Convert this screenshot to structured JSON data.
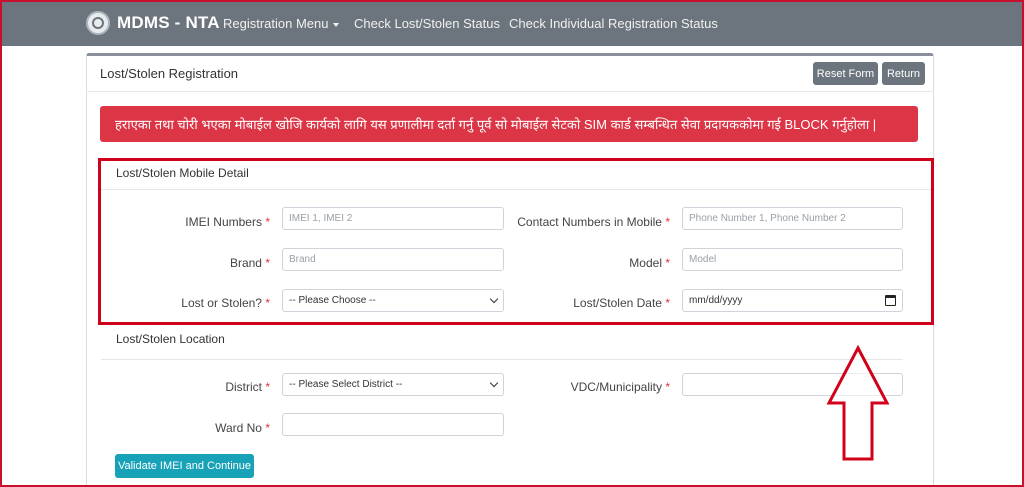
{
  "navbar": {
    "brand": "MDMS - NTA",
    "links": [
      "Registration Menu",
      "Check Lost/Stolen Status",
      "Check Individual Registration Status"
    ]
  },
  "card": {
    "title": "Lost/Stolen Registration",
    "reset_label": "Reset Form",
    "return_label": "Return"
  },
  "alert": {
    "text": "हराएका तथा चोरी भएका मोबाईल खोजि कार्यको लागि यस प्रणालीमा दर्ता गर्नु पूर्व सो मोबाईल सेटको SIM कार्ड सम्बन्धित सेवा प्रदायककोमा गई BLOCK गर्नुहोला |"
  },
  "mobile_detail": {
    "title": "Lost/Stolen Mobile Detail",
    "imei_label": "IMEI Numbers",
    "imei_placeholder": "IMEI 1, IMEI 2",
    "contact_label": "Contact Numbers in Mobile",
    "contact_placeholder": "Phone Number 1, Phone Number 2",
    "brand_label": "Brand",
    "brand_placeholder": "Brand",
    "model_label": "Model",
    "model_placeholder": "Model",
    "lost_label": "Lost or Stolen?",
    "lost_value": "-- Please Choose --",
    "date_label": "Lost/Stolen Date",
    "date_value": "mm/dd/yyyy"
  },
  "location": {
    "title": "Lost/Stolen Location",
    "district_label": "District",
    "district_value": "-- Please Select District --",
    "vdc_label": "VDC/Municipality",
    "ward_label": "Ward No"
  },
  "actions": {
    "validate_label": "Validate IMEI and Continue"
  },
  "required_mark": "*",
  "colors": {
    "navbar": "#6c757d",
    "alert": "#dc3545",
    "validate": "#17a2b8",
    "highlight": "#d0021b"
  }
}
